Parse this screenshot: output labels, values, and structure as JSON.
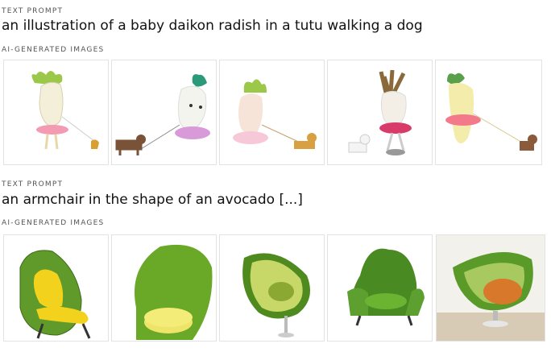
{
  "section1": {
    "prompt_label": "TEXT PROMPT",
    "prompt_text": "an illustration of a baby daikon radish in a tutu walking a dog",
    "images_label": "AI-GENERATED IMAGES",
    "images": [
      "daikon-image-1",
      "daikon-image-2",
      "daikon-image-3",
      "daikon-image-4",
      "daikon-image-5"
    ]
  },
  "section2": {
    "prompt_label": "TEXT PROMPT",
    "prompt_text": "an armchair in the shape of an avocado [...]",
    "images_label": "AI-GENERATED IMAGES",
    "images": [
      "avocado-chair-image-1",
      "avocado-chair-image-2",
      "avocado-chair-image-3",
      "avocado-chair-image-4",
      "avocado-chair-image-5"
    ]
  },
  "colors": {
    "daikon_body": "#f4efd8",
    "daikon_leaves": "#9cc84a",
    "tutu": "#f29bb2",
    "dog": "#8a5a3a",
    "avocado_skin": "#5f9a2a",
    "avocado_flesh": "#d8e070",
    "seat_yellow": "#f2d21c",
    "pit_orange": "#d8782a"
  }
}
